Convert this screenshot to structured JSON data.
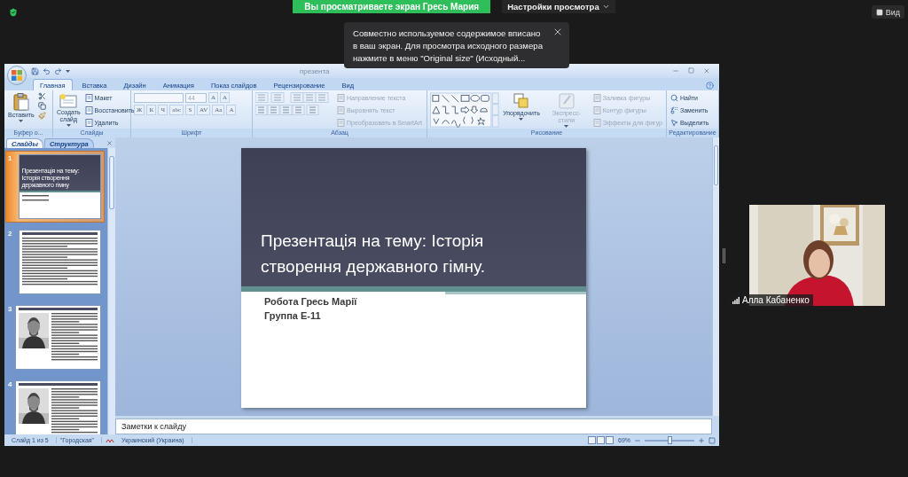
{
  "top_bar": {
    "banner": "Вы просматриваете экран Гресь Мария",
    "view_options": "Настройки просмотра",
    "view_button": "Вид"
  },
  "notice": {
    "text": "Совместно используемое содержимое вписано в ваш экран. Для просмотра исходного размера нажмите в меню \"Original size\" (Исходный..."
  },
  "powerpoint": {
    "title": "презента",
    "tabs": [
      {
        "label": "Главная",
        "selected": true
      },
      {
        "label": "Вставка",
        "selected": false
      },
      {
        "label": "Дизайн",
        "selected": false
      },
      {
        "label": "Анимация",
        "selected": false
      },
      {
        "label": "Показ слайдов",
        "selected": false
      },
      {
        "label": "Рецензирование",
        "selected": false
      },
      {
        "label": "Вид",
        "selected": false
      }
    ],
    "ribbon": [
      {
        "kind": "clipboard",
        "label": "Буфер о...",
        "paste": "Вставить"
      },
      {
        "kind": "slides",
        "label": "Слайды",
        "new_slide": "Создать слайд",
        "items": [
          {
            "label": "Макет",
            "disabled": false
          },
          {
            "label": "Восстановить",
            "disabled": false
          },
          {
            "label": "Удалить",
            "disabled": false
          }
        ]
      },
      {
        "kind": "font",
        "label": "Шрифт",
        "size": "44",
        "grow_buttons": [
          "A",
          "A"
        ],
        "format_buttons": [
          "Ж",
          "К",
          "Ч",
          "abc",
          "S",
          "AV",
          "Aa",
          "A"
        ]
      },
      {
        "kind": "paragraph",
        "label": "Абзац",
        "items": [
          {
            "label": "Направление текста",
            "disabled": true
          },
          {
            "label": "Выровнять текст",
            "disabled": true
          },
          {
            "label": "Преобразовать в SmartArt",
            "disabled": true
          }
        ]
      },
      {
        "kind": "drawing",
        "label": "Рисование",
        "arrange": "Упорядочить",
        "quick_styles": {
          "label": "Экспресс-стили",
          "disabled": true
        },
        "items": [
          {
            "label": "Заливка фигуры",
            "disabled": true
          },
          {
            "label": "Контур фигуры",
            "disabled": true
          },
          {
            "label": "Эффекты для фигур",
            "disabled": true
          }
        ]
      },
      {
        "kind": "editing",
        "label": "Редактирование",
        "items": [
          {
            "label": "Найти",
            "disabled": false
          },
          {
            "label": "Заменить",
            "disabled": false
          },
          {
            "label": "Выделить",
            "disabled": false
          }
        ]
      }
    ],
    "slides_pane": {
      "tabs": [
        {
          "label": "Слайды",
          "selected": true
        },
        {
          "label": "Структура",
          "selected": false
        }
      ],
      "thumbnails": [
        {
          "number": "1",
          "kind": "title",
          "selected": true,
          "title": "Презентація на тему: Історія створення державного гімну"
        },
        {
          "number": "2",
          "kind": "text",
          "selected": false
        },
        {
          "number": "3",
          "kind": "portrait",
          "selected": false
        },
        {
          "number": "4",
          "kind": "portrait",
          "selected": false
        }
      ]
    },
    "slide": {
      "title": "Презентація на тему: Історія створення державного гімну.",
      "subtitle_lines": [
        "Робота Гресь Марії",
        "Группа Е-11"
      ]
    },
    "notes": {
      "placeholder": "Заметки к слайду"
    },
    "status_bar": {
      "slide": "Слайд 1 из 5",
      "theme": "\"Городская\"",
      "language": "Украинский (Украина)",
      "zoom": "69%",
      "zoom_slider": {
        "level": 0.5
      }
    }
  },
  "video": {
    "name": "Алла Кабаненко"
  }
}
